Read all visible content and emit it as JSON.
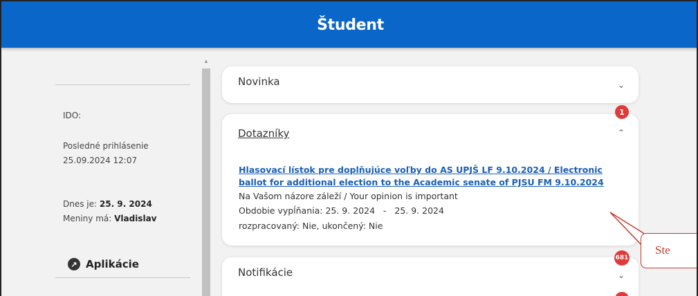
{
  "header": {
    "title": "Študent"
  },
  "sidebar": {
    "ido_label": "IDO:",
    "last_login_label": "Posledné prihlásenie",
    "last_login_value": "25.09.2024 12:07",
    "today_label": "Dnes je: ",
    "today_value": "25. 9. 2024",
    "nameday_label": "Meniny má: ",
    "nameday_value": "Vladislav",
    "apps_label": "Aplikácie",
    "apps_icon": "arrow-up-right-circle-icon"
  },
  "cards": {
    "novinka": {
      "title": "Novinka"
    },
    "dotazniky": {
      "title": "Dotazníky",
      "badge": "1",
      "survey_title": "Hlasovací lístok pre doplňujúce voľby do AS UPJŠ LF 9.10.2024 / Electronic ballot for additional election to the Academic senate of PJSU FM 9.10.2024",
      "subtitle": "Na Vašom názore záleží / Your opinion is important",
      "period": "Obdobie vypĺňania: 25. 9. 2024   -   25. 9. 2024",
      "status": "rozpracovaný: Nie, ukončený: Nie"
    },
    "notifikacie": {
      "title": "Notifikácie",
      "badge": "681"
    }
  },
  "callout": {
    "text": "Ste"
  },
  "colors": {
    "header": "#0a66c8",
    "badge": "#e03b3b",
    "link": "#1a5fb4",
    "callout": "#c0392b"
  }
}
